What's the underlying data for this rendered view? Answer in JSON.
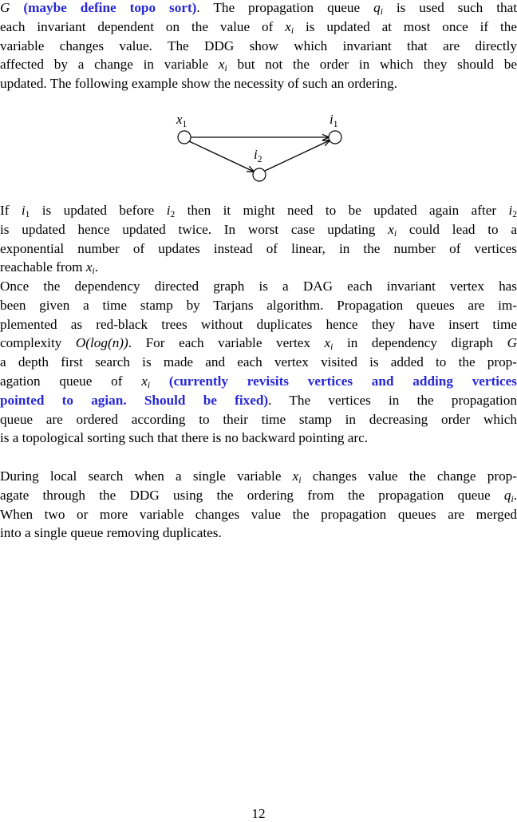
{
  "intro": {
    "line1": {
      "symbol": "G",
      "note": "(maybe define topo sort)",
      "text_a": ". The propagation queue ",
      "q": "q",
      "q_sub": "i",
      "text_b": " is used such that"
    },
    "line2": {
      "text_a": "each invariant dependent on the value of ",
      "x": "x",
      "x_sub": "i",
      "text_b": " is updated at most once if the"
    },
    "line3": "variable changes value.  The DDG show which invariant that are directly",
    "line4": {
      "text_a": "affected by a change in variable ",
      "x": "x",
      "x_sub": "i",
      "text_b": " but not the order in which they should be"
    },
    "line5": "updated. The following example show the necessity of such an ordering."
  },
  "diagram": {
    "nodes": [
      {
        "id": "x1",
        "label": "x",
        "sub": "1"
      },
      {
        "id": "i1",
        "label": "i",
        "sub": "1"
      },
      {
        "id": "i2",
        "label": "i",
        "sub": "2"
      }
    ],
    "edges": [
      {
        "from": "x1",
        "to": "i1"
      },
      {
        "from": "x1",
        "to": "i2"
      },
      {
        "from": "i2",
        "to": "i1"
      }
    ]
  },
  "para2": {
    "line1": {
      "t1": "If ",
      "i1": "i",
      "i1_sub": "1",
      "t2": " is updated before ",
      "i2": "i",
      "i2_sub": "2",
      "t3": " then it might need to be updated again after ",
      "i3": "i",
      "i3_sub": "2"
    },
    "line2": {
      "text_a": "is updated hence updated twice. In worst case updating ",
      "x": "x",
      "x_sub": "i",
      "text_b": " could lead to a"
    },
    "line3": "exponential number of updates instead of linear, in the number of vertices",
    "line4": {
      "text_a": "reachable from ",
      "x": "x",
      "x_sub": "i",
      "text_b": "."
    }
  },
  "para3": {
    "line1": "Once the dependency directed graph is a DAG each invariant vertex has",
    "line2": "been given a time stamp by Tarjans algorithm. Propagation queues are im-",
    "line3": "plemented as red-black trees without duplicates hence they have insert time",
    "line4": {
      "text_a": "complexity ",
      "formula": "O(log(n))",
      "text_b": ". For each variable vertex ",
      "x": "x",
      "x_sub": "i",
      "text_c": " in dependency digraph ",
      "g": "G"
    },
    "line5": "a depth first search is made and each vertex visited is added to the prop-",
    "line6": {
      "text_a": "agation queue of ",
      "x": "x",
      "x_sub": "i",
      "note": " (currently revisits vertices and adding vertices"
    },
    "line7": {
      "note": "pointed to agian.  Should be fixed)",
      "text_b": ".  The vertices in the propagation"
    },
    "line8": "queue are ordered according to their time stamp in decreasing order which",
    "line9": "is a topological sorting such that there is no backward pointing arc."
  },
  "para4": {
    "line1": {
      "text_a": "During local search when a single variable ",
      "x": "x",
      "x_sub": "i",
      "text_b": " changes value the change prop-"
    },
    "line2": {
      "text_a": "agate through the DDG using the ordering from the propagation queue ",
      "q": "q",
      "q_sub": "i",
      "text_b": "."
    },
    "line3": "When two or more variable changes value the propagation queues are merged",
    "line4": "into a single queue removing duplicates."
  },
  "page_number": "12"
}
